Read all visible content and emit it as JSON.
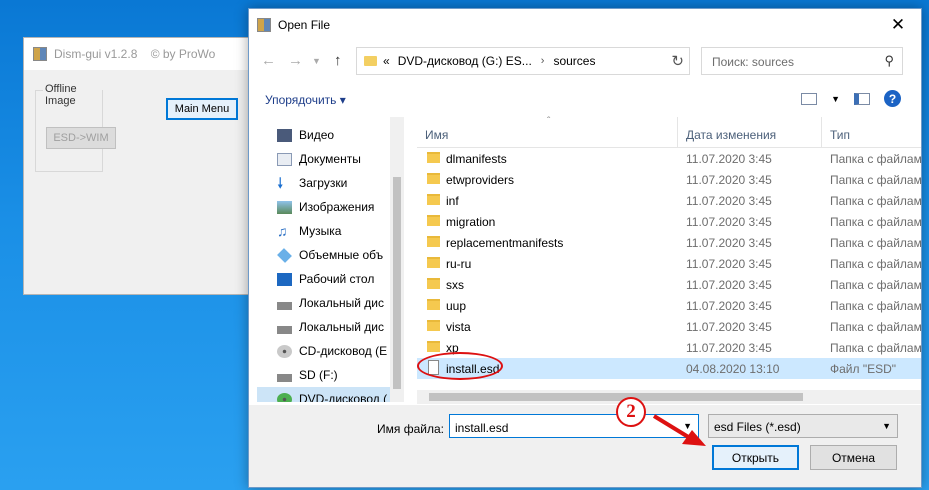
{
  "dism": {
    "title": "Dism-gui v1.2.8    © by ProWo",
    "group_label": "Offline Image",
    "esd_button": "ESD->WIM",
    "main_menu_button": "Main Menu"
  },
  "dialog": {
    "title": "Open File",
    "close": "✕",
    "address": [
      "«",
      "DVD-дисковод (G:) ES...",
      "›",
      "sources"
    ],
    "search_placeholder": "Поиск: sources",
    "organize": "Упорядочить ▾",
    "nav_items": [
      "Видео",
      "Документы",
      "Загрузки",
      "Изображения",
      "Музыка",
      "Объемные объ",
      "Рабочий стол",
      "Локальный дис",
      "Локальный дис",
      "CD-дисковод (E",
      "SD (F:)",
      "DVD-дисковод ("
    ],
    "columns": {
      "name": "Имя",
      "date": "Дата изменения",
      "type": "Тип"
    },
    "rows": [
      {
        "name": "dlmanifests",
        "date": "11.07.2020 3:45",
        "type": "Папка с файлам"
      },
      {
        "name": "etwproviders",
        "date": "11.07.2020 3:45",
        "type": "Папка с файлам"
      },
      {
        "name": "inf",
        "date": "11.07.2020 3:45",
        "type": "Папка с файлам"
      },
      {
        "name": "migration",
        "date": "11.07.2020 3:45",
        "type": "Папка с файлам"
      },
      {
        "name": "replacementmanifests",
        "date": "11.07.2020 3:45",
        "type": "Папка с файлам"
      },
      {
        "name": "ru-ru",
        "date": "11.07.2020 3:45",
        "type": "Папка с файлам"
      },
      {
        "name": "sxs",
        "date": "11.07.2020 3:45",
        "type": "Папка с файлам"
      },
      {
        "name": "uup",
        "date": "11.07.2020 3:45",
        "type": "Папка с файлам"
      },
      {
        "name": "vista",
        "date": "11.07.2020 3:45",
        "type": "Папка с файлам"
      },
      {
        "name": "xp",
        "date": "11.07.2020 3:45",
        "type": "Папка с файлам"
      },
      {
        "name": "install.esd",
        "date": "04.08.2020 13:10",
        "type": "Файл \"ESD\""
      }
    ],
    "filename_label": "Имя файла:",
    "filename_value": "install.esd",
    "filter": "esd Files (*.esd)",
    "open_button": "Открыть",
    "cancel_button": "Отмена"
  },
  "annotation": {
    "step_number": "2",
    "color": "#dd1111"
  }
}
